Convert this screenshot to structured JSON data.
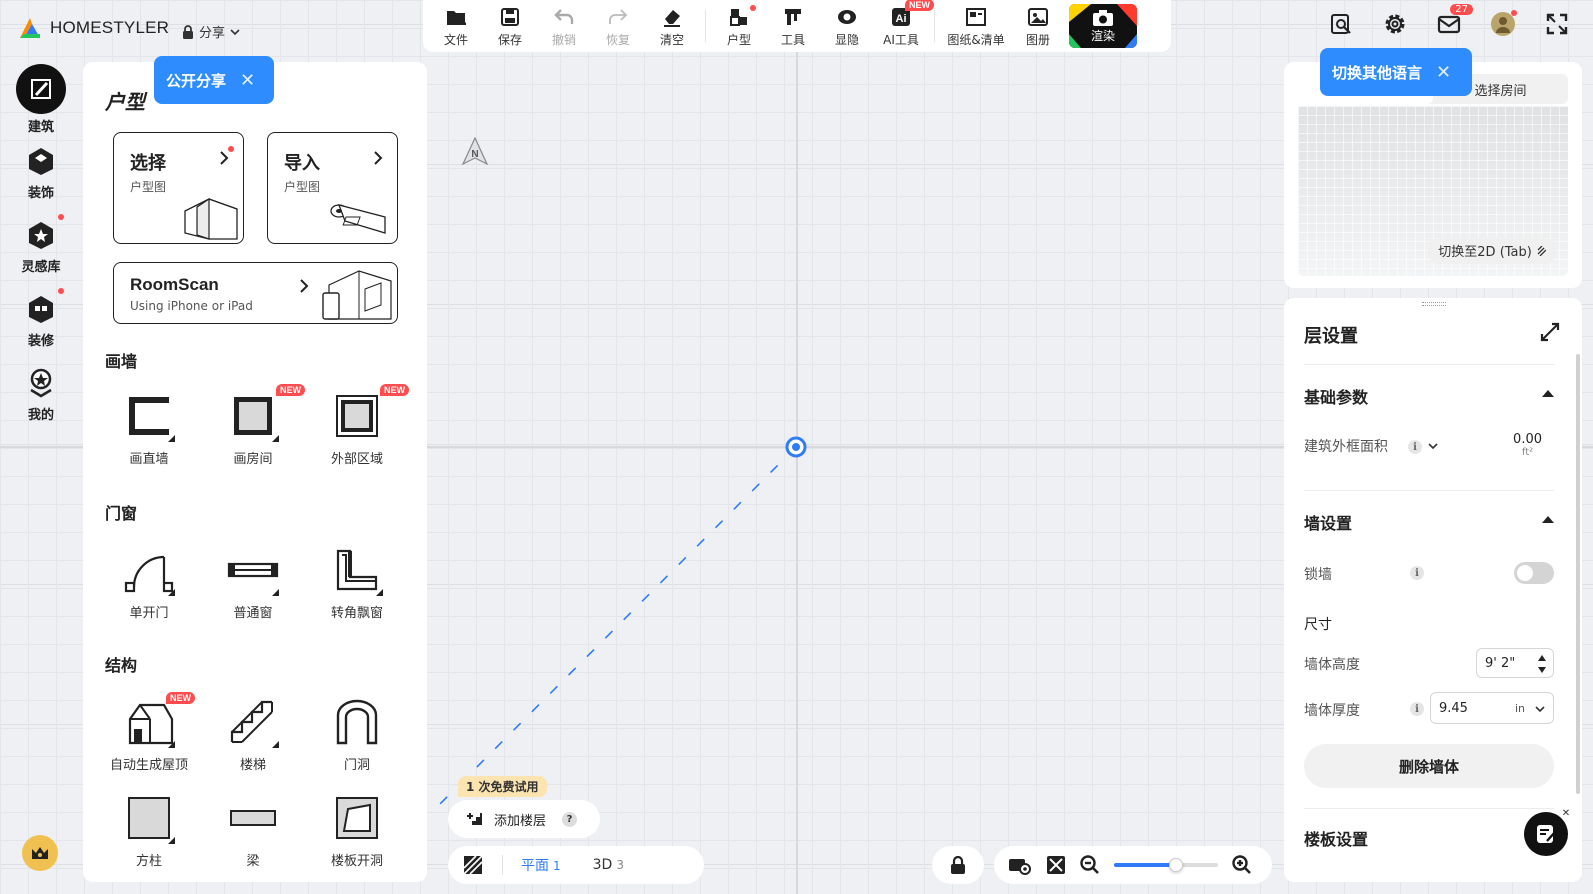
{
  "brand": {
    "name": "HOMESTYLER"
  },
  "share": {
    "label": "分享"
  },
  "toolbar": {
    "file": "文件",
    "save": "保存",
    "undo": "撤销",
    "redo": "恢复",
    "clear": "清空",
    "floorplan": "户型",
    "tools": "工具",
    "visibility": "显隐",
    "ai_tools": "AI工具",
    "ai_badge": "NEW",
    "drawings": "图纸&清单",
    "album": "图册",
    "render": "渲染"
  },
  "top_right": {
    "mail_count": "27"
  },
  "rail": {
    "items": [
      {
        "label": "建筑"
      },
      {
        "label": "装饰"
      },
      {
        "label": "灵感库"
      },
      {
        "label": "装修"
      },
      {
        "label": "我的"
      }
    ]
  },
  "tooltips": {
    "public_share": "公开分享",
    "switch_language": "切换其他语言"
  },
  "panel": {
    "title": "户型",
    "select_card": {
      "title": "选择",
      "subtitle": "户型图"
    },
    "import_card": {
      "title": "导入",
      "subtitle": "户型图"
    },
    "roomscan_card": {
      "title": "RoomScan",
      "subtitle": "Using iPhone or iPad"
    },
    "wall_section": {
      "title": "画墙",
      "tools": [
        {
          "label": "画直墙"
        },
        {
          "label": "画房间",
          "badge": "NEW"
        },
        {
          "label": "外部区域",
          "badge": "NEW"
        }
      ]
    },
    "door_section": {
      "title": "门窗",
      "tools": [
        {
          "label": "单开门"
        },
        {
          "label": "普通窗"
        },
        {
          "label": "转角飘窗"
        }
      ]
    },
    "struct_section": {
      "title": "结构",
      "tools": [
        {
          "label": "自动生成屋顶",
          "badge": "NEW"
        },
        {
          "label": "楼梯"
        },
        {
          "label": "门洞"
        },
        {
          "label": "方柱"
        },
        {
          "label": "梁"
        },
        {
          "label": "楼板开洞"
        }
      ]
    }
  },
  "canvas": {
    "north": "N",
    "trial_badge": "1 次免费试用",
    "add_floor": "添加楼层",
    "help": "?"
  },
  "view_tabs": [
    {
      "label": "平面",
      "count": "1"
    },
    {
      "label": "3D",
      "count": "3"
    }
  ],
  "zoom": {
    "level": 0.6
  },
  "preview": {
    "tab_selected": "",
    "tab_room": "选择房间",
    "switch_2d": "切换至2D (Tab)"
  },
  "settings": {
    "title": "层设置",
    "basic": {
      "title": "基础参数",
      "area_label": "建筑外框面积",
      "area_value": "0.00",
      "area_unit": "ft²"
    },
    "wall": {
      "title": "墙设置",
      "lock_label": "锁墙",
      "size_label": "尺寸",
      "height_label": "墙体高度",
      "height_value": "9' 2\"",
      "thickness_label": "墙体厚度",
      "thickness_value": "9.45",
      "thickness_unit": "in",
      "delete_label": "删除墙体"
    },
    "floor": {
      "title": "楼板设置"
    }
  },
  "colors": {
    "accent": "#2f7cf6",
    "tooltip": "#2f8cff",
    "badge": "#ff4d4f"
  }
}
